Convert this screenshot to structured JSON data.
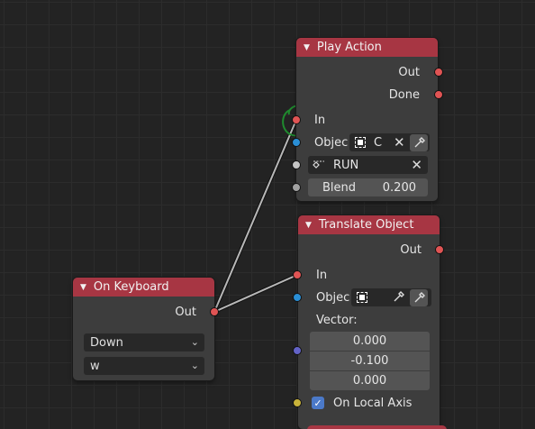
{
  "nodes": {
    "play_action": {
      "title": "Play Action",
      "outputs": {
        "out": "Out",
        "done": "Done"
      },
      "inputs": {
        "in": "In",
        "object": "Objec",
        "object_value": "C"
      },
      "action": {
        "name": "RUN"
      },
      "blend": {
        "label": "Blend",
        "value": "0.200"
      }
    },
    "translate_object": {
      "title": "Translate Object",
      "outputs": {
        "out": "Out"
      },
      "inputs": {
        "in": "In",
        "object": "Objec",
        "vector_label": "Vector:"
      },
      "vector": [
        "0.000",
        "-0.100",
        "0.000"
      ],
      "local_axis": {
        "label": "On Local Axis",
        "checked": true
      }
    },
    "on_keyboard": {
      "title": "On Keyboard",
      "outputs": {
        "out": "Out"
      },
      "event_select": "Down",
      "key_select": "w"
    }
  },
  "colors": {
    "header": "#a73643",
    "socket_logic": "#e05454",
    "socket_object": "#2a8fd6",
    "socket_vector": "#6363c7",
    "socket_generic": "#a1a1a1",
    "socket_bool": "#c9b33a",
    "annotation": "#1f8a2e"
  },
  "icons": {
    "collapse": "triangle-down-icon",
    "object": "object-icon",
    "eyedropper": "eyedropper-icon",
    "clear": "close-icon",
    "action": "action-icon"
  }
}
